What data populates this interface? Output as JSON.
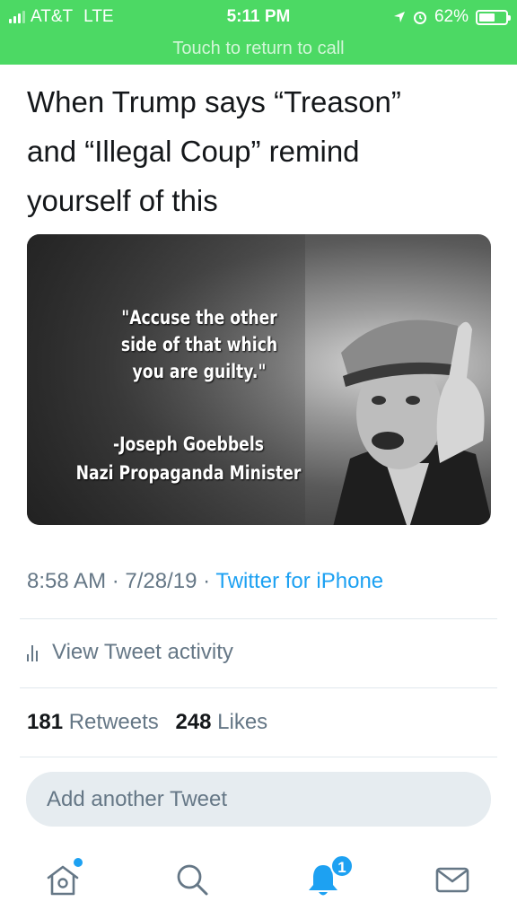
{
  "status_bar": {
    "carrier": "AT&T",
    "network": "LTE",
    "time": "5:11 PM",
    "battery_percent": "62%",
    "battery_level": 0.62
  },
  "call_banner": {
    "text": "Touch to return to call"
  },
  "tweet": {
    "text_lines": [
      "When Trump says “Treason”",
      "and “Illegal Coup” remind",
      "yourself of this"
    ],
    "image": {
      "quote_lines": [
        "\"Accuse the other",
        "side of that which",
        "you are guilty.\""
      ],
      "attribution_lines": [
        "-Joseph Goebbels",
        "Nazi Propaganda Minister"
      ]
    },
    "time": "8:58 AM",
    "date": "7/28/19",
    "separator": "·",
    "source": "Twitter for iPhone"
  },
  "activity": {
    "label": "View Tweet activity",
    "icon": "bar-chart-icon"
  },
  "stats": {
    "retweets_count": "181",
    "retweets_label": "Retweets",
    "likes_count": "248",
    "likes_label": "Likes"
  },
  "compose": {
    "placeholder": "Add another Tweet"
  },
  "tab_bar": {
    "home_icon": "home-icon",
    "search_icon": "search-icon",
    "notifications_icon": "bell-icon",
    "notifications_badge": "1",
    "messages_icon": "mail-icon",
    "accent_color": "#1da1f2"
  }
}
